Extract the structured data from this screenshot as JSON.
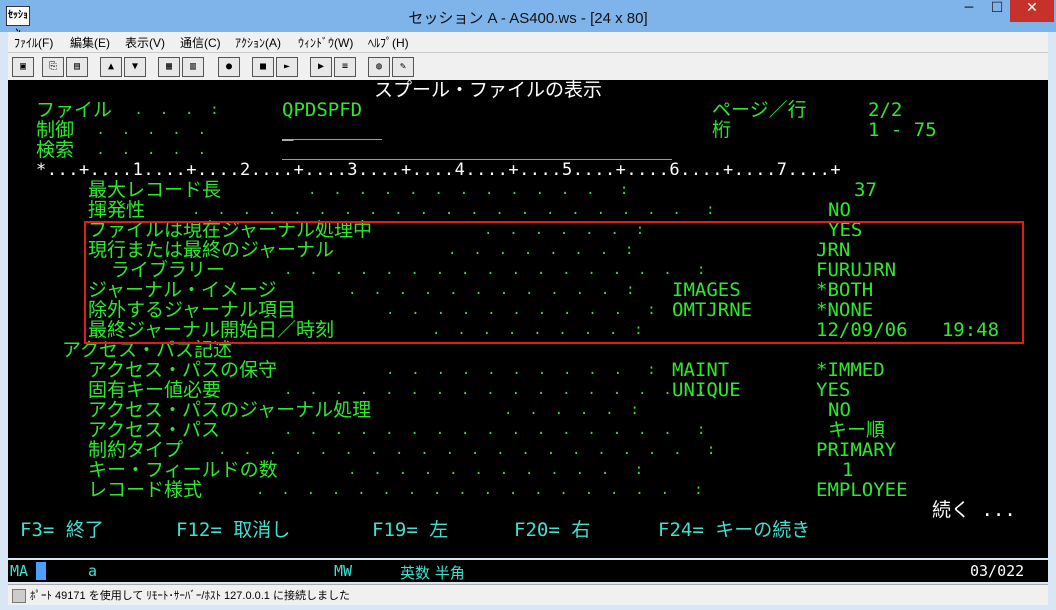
{
  "window": {
    "title": "セッション A - AS400.ws - [24 x 80]",
    "app_icon_text": "ｾｯｼｮﾝ",
    "minimize": "─",
    "maximize": "☐",
    "close": "✕"
  },
  "menu": [
    "ﾌｧｲﾙ(F)",
    "編集(E)",
    "表示(V)",
    "通信(C)",
    "ｱｸｼｮﾝ(A)",
    "ｳｨﾝﾄﾞｳ(W)",
    "ﾍﾙﾌﾟ(H)"
  ],
  "toolbar_icons": [
    "print-screen-icon",
    "copy-icon",
    "paste-icon",
    "send-icon",
    "receive-icon",
    "display-icon",
    "keyboard-icon",
    "macro-record-icon",
    "macro-stop-icon",
    "macro-play-icon",
    "macro-run-icon",
    "web-icon",
    "edit-icon"
  ],
  "screen": {
    "title": "スプール・ファイルの表示",
    "file_label": "ファイル",
    "file_dots": " .  .  .  :",
    "file_value": "QPDSPFD",
    "page_label": "ページ／行",
    "page_value": "2/2",
    "control_label": "制御",
    "control_dots": " .  .  .  .  .",
    "column_label": "桁",
    "column_value": "1 - 75",
    "search_label": "検索",
    "search_dots": " .  .  .  .  .",
    "ruler": "*...+....1....+....2....+....3....+....4....+....5....+....6....+....7....+",
    "rows": [
      {
        "label": "最大レコード長",
        "keyword": "",
        "value": "37"
      },
      {
        "label": "揮発性",
        "keyword": "",
        "value": "NO"
      },
      {
        "label": "ファイルは現在ジャーナル処理中",
        "keyword": "",
        "value": "YES"
      },
      {
        "label": "現行または最終のジャーナル",
        "keyword": "",
        "value": "JRN"
      },
      {
        "label": "  ライブラリー",
        "keyword": "",
        "value": "FURUJRN"
      },
      {
        "label": "ジャーナル・イメージ",
        "keyword": "IMAGES",
        "value": "*BOTH"
      },
      {
        "label": "除外するジャーナル項目",
        "keyword": "OMTJRNE",
        "value": "*NONE"
      },
      {
        "label": "最終ジャーナル開始日／時刻",
        "keyword": "",
        "value": "12/09/06   19:48"
      },
      {
        "label": "アクセス・パス記述",
        "keyword": "",
        "value": ""
      },
      {
        "label": "アクセス・パスの保守",
        "keyword": "MAINT",
        "value": "*IMMED"
      },
      {
        "label": "固有キー値必要",
        "keyword": "UNIQUE",
        "value": "YES"
      },
      {
        "label": "アクセス・パスのジャーナル処理",
        "keyword": "",
        "value": "NO"
      },
      {
        "label": "アクセス・パス",
        "keyword": "",
        "value": "キー順"
      },
      {
        "label": "制約タイプ",
        "keyword": "",
        "value": "PRIMARY"
      },
      {
        "label": "キー・フィールドの数",
        "keyword": "",
        "value": "1"
      },
      {
        "label": "レコード様式",
        "keyword": "",
        "value": "EMPLOYEE"
      }
    ],
    "more": "続く ...",
    "fkeys": [
      "F3= 終了",
      "F12= 取消し",
      "F19= 左",
      "F20= 右",
      "F24= キーの続き"
    ]
  },
  "status": {
    "ma": "MA",
    "a": "a",
    "mw": "MW",
    "mode": "英数 半角",
    "pos": "03/022"
  },
  "connection": "ﾎﾟｰﾄ 49171 を使用して ﾘﾓｰﾄ･ｻｰﾊﾞｰ/ﾎｽﾄ 127.0.0.1 に接続しました"
}
